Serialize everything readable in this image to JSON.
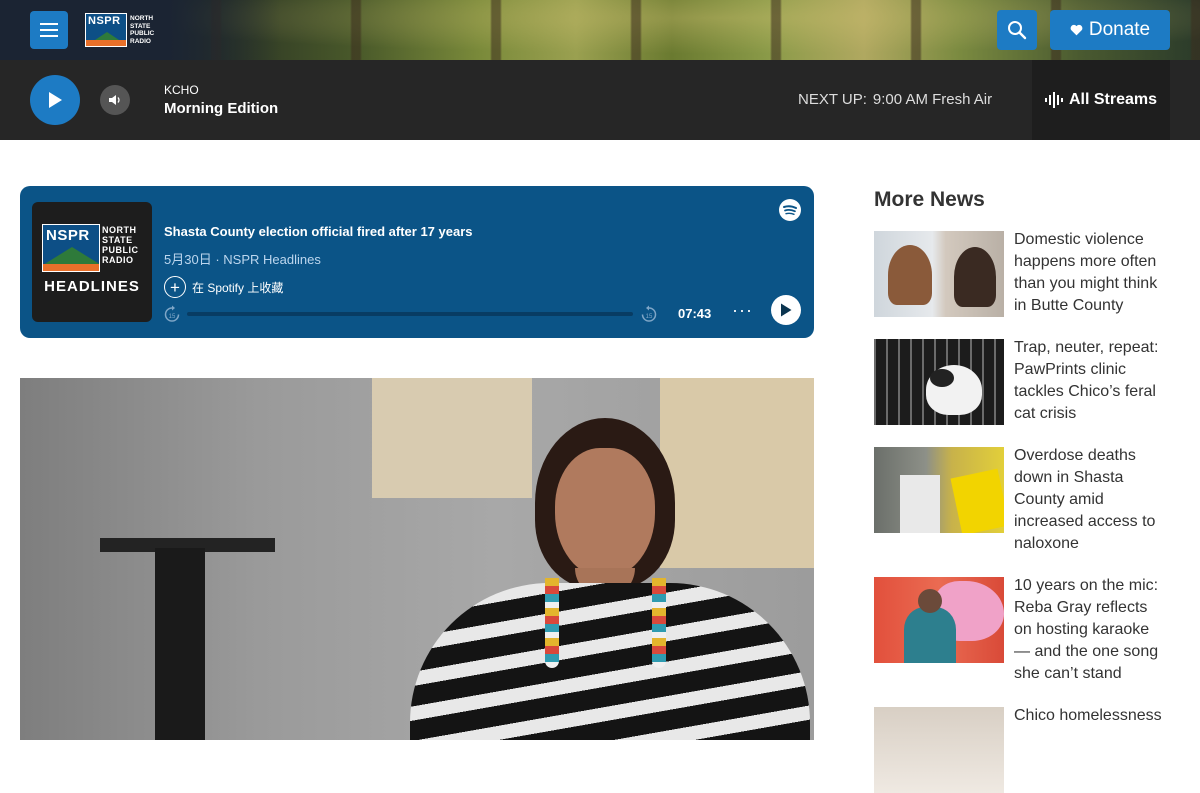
{
  "header": {
    "logo_lines": [
      "NORTH",
      "STATE",
      "PUBLIC",
      "RADIO"
    ],
    "logo_mark": "NSPR",
    "donate_label": "Donate",
    "icons": {
      "menu": "hamburger-icon",
      "search": "search-icon",
      "donate": "heart-icon"
    },
    "accent_color": "#1d7bc4"
  },
  "player": {
    "station": "KCHO",
    "program": "Morning Edition",
    "next_up_label": "NEXT UP:",
    "next_up_time": "9:00 AM",
    "next_up_program": "Fresh Air",
    "all_streams_label": "All Streams"
  },
  "embed": {
    "cover_mark": "NSPR",
    "cover_lines": [
      "NORTH",
      "STATE",
      "PUBLIC",
      "RADIO"
    ],
    "cover_title": "HEADLINES",
    "episode_title": "Shasta County election official fired after 17 years",
    "date": "5月30日",
    "separator": "·",
    "show": "NSPR Headlines",
    "save_label": "在 Spotify 上收藏",
    "skip_back": "15",
    "skip_forward": "15",
    "duration": "07:43",
    "more": "···",
    "background_color": "#0b5487"
  },
  "sidebar": {
    "title": "More News",
    "items": [
      {
        "headline": "Domestic violence happens more often than you might think in Butte County"
      },
      {
        "headline": "Trap, neuter, repeat: PawPrints clinic tackles Chico’s feral cat crisis"
      },
      {
        "headline": "Overdose deaths down in Shasta County amid increased access to naloxone"
      },
      {
        "headline": "10 years on the mic: Reba Gray reflects on hosting karaoke — and the one song she can’t stand"
      },
      {
        "headline": "Chico homelessness"
      }
    ]
  }
}
